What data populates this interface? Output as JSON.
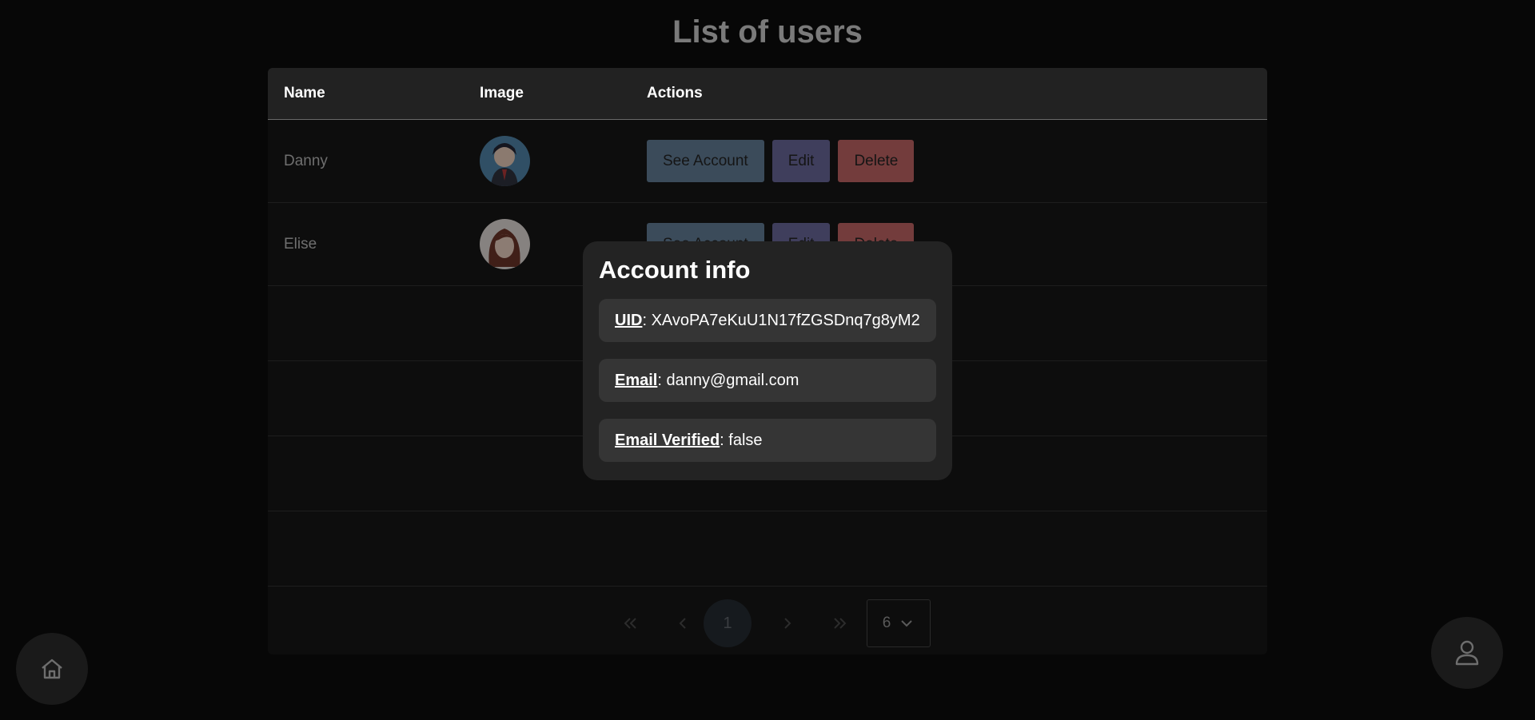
{
  "page_title": "List of users",
  "table": {
    "headers": {
      "name": "Name",
      "image": "Image",
      "actions": "Actions"
    },
    "rows": [
      {
        "name": "Danny",
        "avatar_icon": "avatar-danny"
      },
      {
        "name": "Elise",
        "avatar_icon": "avatar-elise"
      }
    ],
    "actions": {
      "see": "See Account",
      "edit": "Edit",
      "delete": "Delete"
    }
  },
  "pagination": {
    "first_icon": "double-chevron-left-icon",
    "prev_icon": "chevron-left-icon",
    "current_page": "1",
    "next_icon": "chevron-right-icon",
    "last_icon": "double-chevron-right-icon",
    "page_size": "6"
  },
  "modal": {
    "title": "Account info",
    "fields": [
      {
        "key": "UID",
        "value": "XAvoPA7eKuU1N17fZGSDnq7g8yM2"
      },
      {
        "key": "Email",
        "value": "danny@gmail.com"
      },
      {
        "key": "Email Verified",
        "value": "false"
      }
    ]
  },
  "colors": {
    "see_button": "#3b4b5a",
    "edit_button": "#3f3e5c",
    "delete_button": "#733c3c",
    "modal_bg": "#232323"
  },
  "nav": {
    "home_icon": "home-icon",
    "user_icon": "user-icon"
  }
}
